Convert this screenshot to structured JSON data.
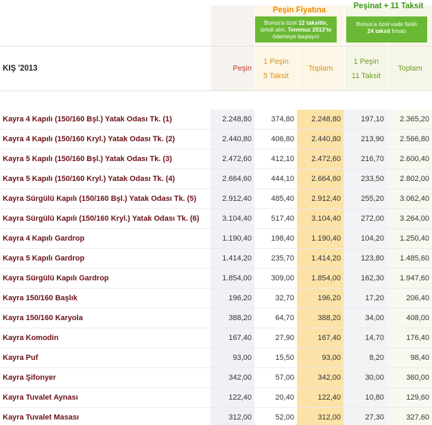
{
  "header": {
    "section_title": "KIŞ '2013",
    "group_pesin": "Peşin Fiyatına",
    "group_pesinat": "Peşinat + 11 Taksit",
    "promo_pesin": {
      "line1_a": "Bonus'a özel",
      "line1_b": "12 taksitle,",
      "line2_a": "şimdi alın,",
      "line2_b": "Temmuz 2013'te",
      "line3": "ödemeye başlayın"
    },
    "promo_pesinat": {
      "line1": "Bonus'a özel vade farklı",
      "line2": "24 taksit",
      "line2_b": "fırsatı"
    },
    "col_pesin": "Peşin",
    "col_1p5t_a": "1 Peşin",
    "col_1p5t_b": "5 Taksit",
    "col_toplam1": "Toplam",
    "col_1p11t_a": "1 Peşin",
    "col_1p11t_b": "11 Taksit",
    "col_toplam2": "Toplam"
  },
  "rows": [
    {
      "name": "Kayra 4 Kapılı (150/160 Bşl.) Yatak Odası Tk. (1)",
      "pesin": "2.248,80",
      "p5": "374,80",
      "t1": "2.248,80",
      "p11": "197,10",
      "t2": "2.365,20"
    },
    {
      "name": "Kayra 4 Kapılı (150/160 Kryl.) Yatak Odası Tk. (2)",
      "pesin": "2.440,80",
      "p5": "406,80",
      "t1": "2.440,80",
      "p11": "213,90",
      "t2": "2.566,80"
    },
    {
      "name": "Kayra 5 Kapılı (150/160 Bşl.) Yatak Odası Tk. (3)",
      "pesin": "2.472,60",
      "p5": "412,10",
      "t1": "2.472,60",
      "p11": "216,70",
      "t2": "2.600,40"
    },
    {
      "name": "Kayra 5 Kapılı (150/160 Kryl.) Yatak Odası Tk. (4)",
      "pesin": "2.664,60",
      "p5": "444,10",
      "t1": "2.664,60",
      "p11": "233,50",
      "t2": "2.802,00"
    },
    {
      "name": "Kayra Sürgülü Kapılı (150/160 Bşl.) Yatak Odası Tk. (5)",
      "pesin": "2.912,40",
      "p5": "485,40",
      "t1": "2.912,40",
      "p11": "255,20",
      "t2": "3.062,40"
    },
    {
      "name": "Kayra Sürgülü Kapılı (150/160 Kryl.) Yatak Odası Tk. (6)",
      "pesin": "3.104,40",
      "p5": "517,40",
      "t1": "3.104,40",
      "p11": "272,00",
      "t2": "3.264,00"
    },
    {
      "name": "Kayra 4 Kapılı Gardrop",
      "pesin": "1.190,40",
      "p5": "198,40",
      "t1": "1.190,40",
      "p11": "104,20",
      "t2": "1.250,40"
    },
    {
      "name": "Kayra 5 Kapılı Gardrop",
      "pesin": "1.414,20",
      "p5": "235,70",
      "t1": "1.414,20",
      "p11": "123,80",
      "t2": "1.485,60"
    },
    {
      "name": "Kayra Sürgülü Kapılı Gardrop",
      "pesin": "1.854,00",
      "p5": "309,00",
      "t1": "1.854,00",
      "p11": "162,30",
      "t2": "1.947,60"
    },
    {
      "name": "Kayra 150/160 Başlık",
      "pesin": "196,20",
      "p5": "32,70",
      "t1": "196,20",
      "p11": "17,20",
      "t2": "206,40"
    },
    {
      "name": "Kayra 150/160 Karyola",
      "pesin": "388,20",
      "p5": "64,70",
      "t1": "388,20",
      "p11": "34,00",
      "t2": "408,00"
    },
    {
      "name": "Kayra Komodin",
      "pesin": "167,40",
      "p5": "27,90",
      "t1": "167,40",
      "p11": "14,70",
      "t2": "176,40"
    },
    {
      "name": "Kayra Puf",
      "pesin": "93,00",
      "p5": "15,50",
      "t1": "93,00",
      "p11": "8,20",
      "t2": "98,40"
    },
    {
      "name": "Kayra Şifonyer",
      "pesin": "342,00",
      "p5": "57,00",
      "t1": "342,00",
      "p11": "30,00",
      "t2": "360,00"
    },
    {
      "name": "Kayra Tuvalet Aynası",
      "pesin": "122,40",
      "p5": "20,40",
      "t1": "122,40",
      "p11": "10,80",
      "t2": "129,60"
    },
    {
      "name": "Kayra Tuvalet Masası",
      "pesin": "312,00",
      "p5": "52,00",
      "t1": "312,00",
      "p11": "27,30",
      "t2": "327,60"
    }
  ]
}
